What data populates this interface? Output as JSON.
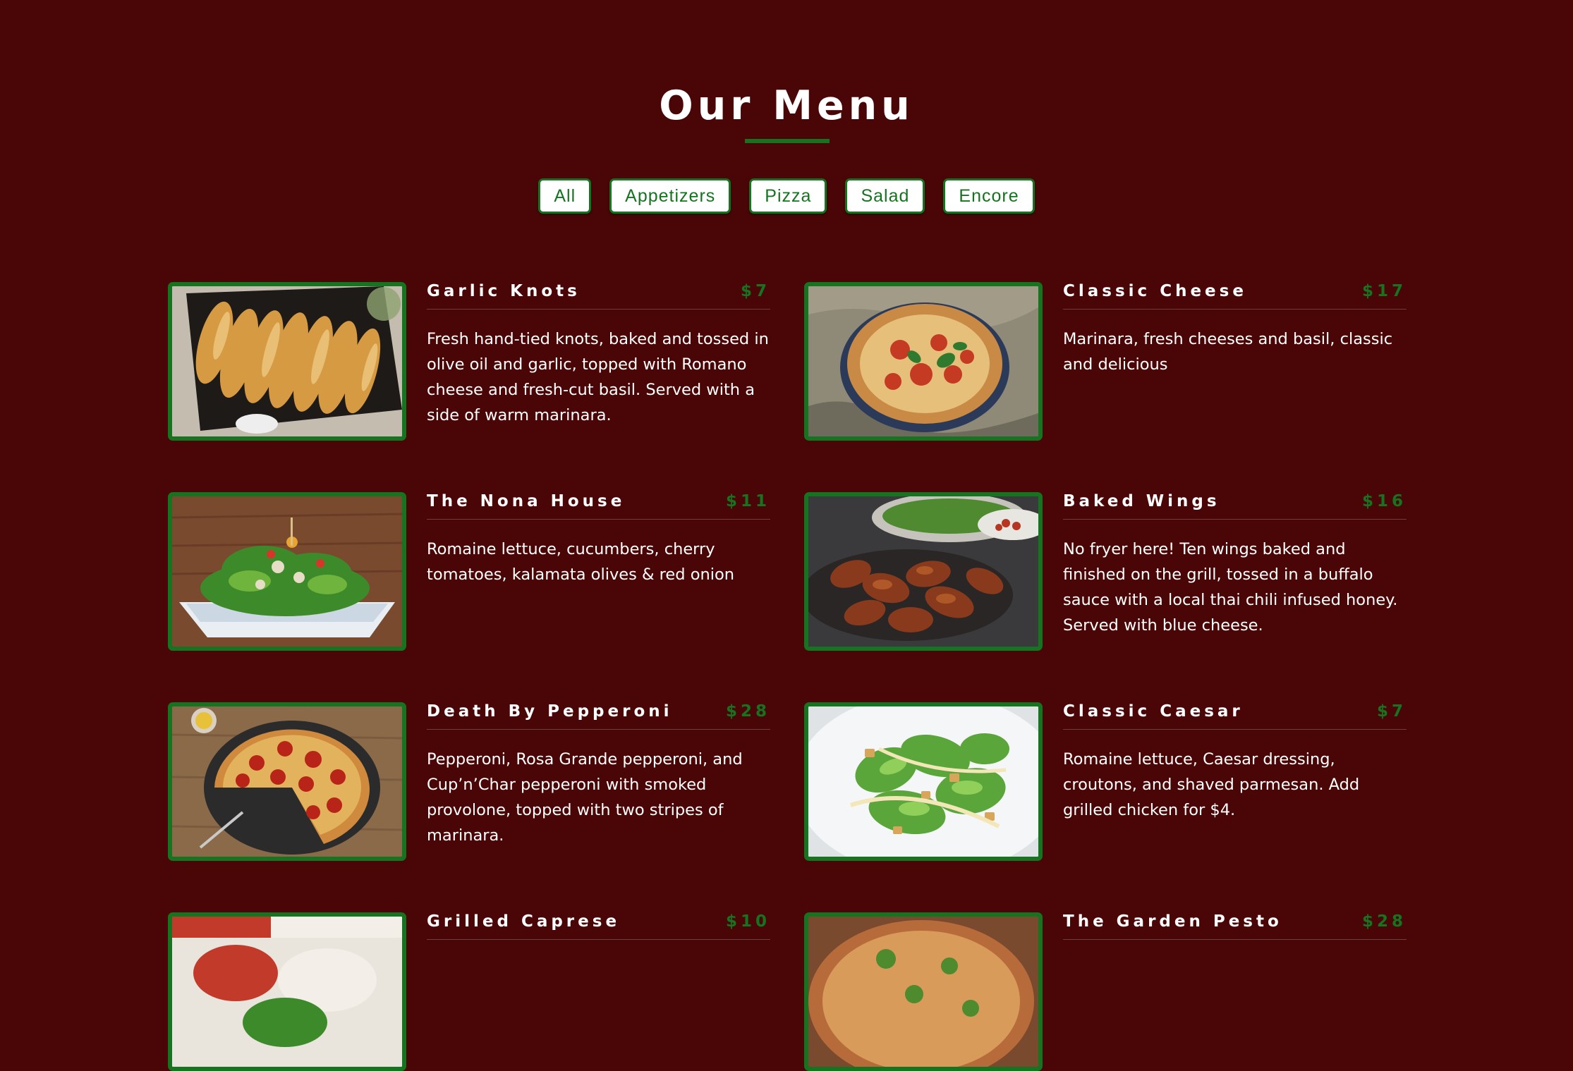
{
  "header": {
    "title": "Our Menu"
  },
  "filters": [
    "All",
    "Appetizers",
    "Pizza",
    "Salad",
    "Encore"
  ],
  "items": [
    {
      "name": "Garlic Knots",
      "price": "$7",
      "description": "Fresh hand-tied knots, baked and tossed in olive oil and garlic, topped with Romano cheese and fresh-cut basil. Served with a side of warm marinara.",
      "photo": "garlic-knots-photo"
    },
    {
      "name": "Classic Cheese",
      "price": "$17",
      "description": "Marinara, fresh cheeses and basil, classic and delicious",
      "photo": "classic-cheese-photo"
    },
    {
      "name": "The Nona House",
      "price": "$11",
      "description": "Romaine lettuce, cucumbers, cherry tomatoes, kalamata olives & red onion",
      "photo": "nona-house-photo"
    },
    {
      "name": "Baked Wings",
      "price": "$16",
      "description": "No fryer here! Ten wings baked and finished on the grill, tossed in a buffalo sauce with a local thai chili infused honey. Served with blue cheese.",
      "photo": "baked-wings-photo"
    },
    {
      "name": "Death By Pepperoni",
      "price": "$28",
      "description": "Pepperoni, Rosa Grande pepperoni, and Cup’n’Char pepperoni with smoked provolone, topped with two stripes of marinara.",
      "photo": "death-by-pepperoni-photo"
    },
    {
      "name": "Classic Caesar",
      "price": "$7",
      "description": "Romaine lettuce, Caesar dressing, croutons, and shaved parmesan. Add grilled chicken for $4.",
      "photo": "classic-caesar-photo"
    },
    {
      "name": "Grilled Caprese",
      "price": "$10",
      "description": "",
      "photo": "grilled-caprese-photo"
    },
    {
      "name": "The Garden Pesto",
      "price": "$28",
      "description": "",
      "photo": "garden-pesto-photo"
    }
  ],
  "colors": {
    "background": "#4a0606",
    "accent": "#15741f",
    "text": "#ffffff"
  }
}
